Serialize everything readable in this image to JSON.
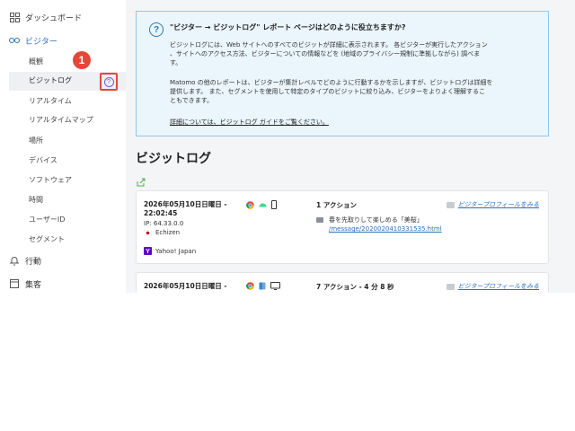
{
  "sidebar": {
    "dashboard": "ダッシュボード",
    "visitors": "ビジター",
    "items": [
      "概観",
      "ビジットログ",
      "リアルタイム",
      "リアルタイムマップ",
      "場所",
      "デバイス",
      "ソフトウェア",
      "時間",
      "ユーザーID",
      "セグメント"
    ],
    "behavior": "行動",
    "acquisition": "集客"
  },
  "annotation": {
    "step": "1"
  },
  "help_panel": {
    "title": "\"ビジター → ビジットログ\" レポート ページはどのように役立ちますか?",
    "para1_lines": [
      "ビジットログには、Web サイトへのすべてのビジットが詳細に表示されます。 各ビジターが実行したアクション",
      "、サイトへのアクセス方法、ビジターについての情報などを (地域のプライバシー規制に準拠しながら) 調べま",
      "す。"
    ],
    "para2_lines": [
      "Matomo の他のレポートは、ビジターが集計レベルでどのように行動するかを示しますが、ビジットログは詳細を",
      "提供します。 また、セグメントを使用して特定のタイプのビジットに絞り込み、ビジターをよりよく理解するこ",
      "ともできます。"
    ],
    "link": "詳細については、ビジットログ ガイドをご覧ください。"
  },
  "main": {
    "title": "ビジットログ"
  },
  "visits": [
    {
      "date_line1": "2026年05月10日日曜日 -",
      "date_line2": "22:02:45",
      "ip": "IP: 64.33.0.0",
      "location": "Echizen",
      "referrer": "Yahoo! Japan",
      "actions": "1 アクション",
      "profile_link": "ビジタープロフィールをみる",
      "page_title": "春を先取りして楽しめる「美桜」",
      "page_url": "/message/2020020410331535.html"
    },
    {
      "date_line1": "2026年05月10日日曜日 -",
      "actions": "7 アクション - 4 分 8 秒",
      "profile_link": "ビジタープロフィールをみる"
    }
  ],
  "colors": {
    "accent_red": "#e2483a",
    "link_blue": "#2a6fc0",
    "panel_bg": "#eaf5fc",
    "panel_border": "#8ec8ea"
  }
}
